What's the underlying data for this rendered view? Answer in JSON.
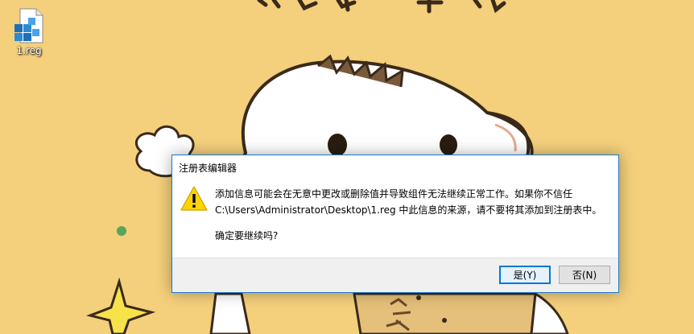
{
  "desktop": {
    "icons": [
      {
        "label": "1.reg",
        "icon": "registry-file-icon"
      }
    ],
    "wallpaper": {
      "description_icon": "cartoon-wallpaper",
      "background_color": "#f4cf7c"
    }
  },
  "dialog": {
    "title": "注册表编辑器",
    "icon": "warning-icon",
    "message_line1": "添加信息可能会在无意中更改或删除值并导致组件无法继续正常工作。如果你不信任",
    "message_line2": "C:\\Users\\Administrator\\Desktop\\1.reg 中此信息的来源，请不要将其添加到注册表中。",
    "confirm": "确定要继续吗?",
    "yes_label": "是(Y)",
    "no_label": "否(N)",
    "accent_color": "#0078d7"
  }
}
